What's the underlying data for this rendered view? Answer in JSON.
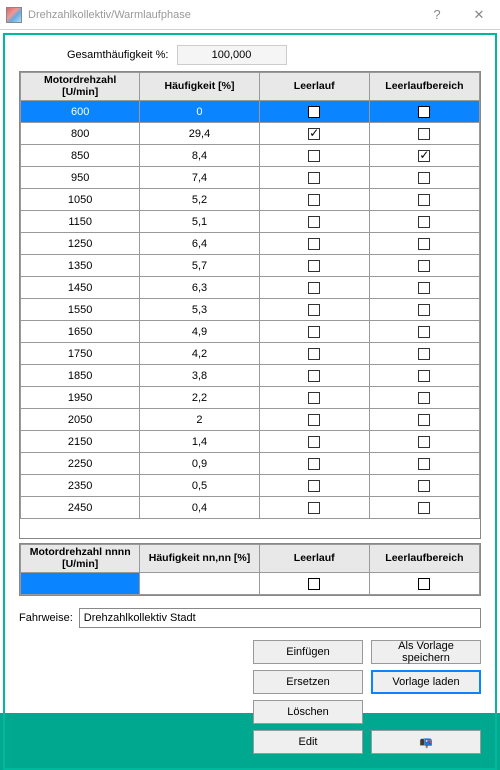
{
  "window": {
    "title": "Drehzahlkollektiv/Warmlaufphase",
    "help": "?",
    "close": "✕"
  },
  "top": {
    "label": "Gesamthäufigkeit %:",
    "value": "100,000"
  },
  "headers": {
    "c1": "Motordrehzahl [U/min]",
    "c2": "Häufigkeit [%]",
    "c3": "Leerlauf",
    "c4": "Leerlauf­bereich"
  },
  "rows": [
    {
      "rpm": "600",
      "freq": "0",
      "leer": false,
      "lb": false,
      "sel": true
    },
    {
      "rpm": "800",
      "freq": "29,4",
      "leer": true,
      "lb": false
    },
    {
      "rpm": "850",
      "freq": "8,4",
      "leer": false,
      "lb": true
    },
    {
      "rpm": "950",
      "freq": "7,4",
      "leer": false,
      "lb": false
    },
    {
      "rpm": "1050",
      "freq": "5,2",
      "leer": false,
      "lb": false
    },
    {
      "rpm": "1150",
      "freq": "5,1",
      "leer": false,
      "lb": false
    },
    {
      "rpm": "1250",
      "freq": "6,4",
      "leer": false,
      "lb": false
    },
    {
      "rpm": "1350",
      "freq": "5,7",
      "leer": false,
      "lb": false
    },
    {
      "rpm": "1450",
      "freq": "6,3",
      "leer": false,
      "lb": false
    },
    {
      "rpm": "1550",
      "freq": "5,3",
      "leer": false,
      "lb": false
    },
    {
      "rpm": "1650",
      "freq": "4,9",
      "leer": false,
      "lb": false
    },
    {
      "rpm": "1750",
      "freq": "4,2",
      "leer": false,
      "lb": false
    },
    {
      "rpm": "1850",
      "freq": "3,8",
      "leer": false,
      "lb": false
    },
    {
      "rpm": "1950",
      "freq": "2,2",
      "leer": false,
      "lb": false
    },
    {
      "rpm": "2050",
      "freq": "2",
      "leer": false,
      "lb": false
    },
    {
      "rpm": "2150",
      "freq": "1,4",
      "leer": false,
      "lb": false
    },
    {
      "rpm": "2250",
      "freq": "0,9",
      "leer": false,
      "lb": false
    },
    {
      "rpm": "2350",
      "freq": "0,5",
      "leer": false,
      "lb": false
    },
    {
      "rpm": "2450",
      "freq": "0,4",
      "leer": false,
      "lb": false
    }
  ],
  "headers2": {
    "c1": "Motordrehzahl nnnn [U/min]",
    "c2": "Häufigkeit nn,nn [%]",
    "c3": "Leerlauf",
    "c4": "Leerlauf­bereich"
  },
  "fahr": {
    "label": "Fahrweise:",
    "value": "Drehzahlkollektiv Stadt"
  },
  "buttons": {
    "einfuegen": "Einfügen",
    "als_vorlage": "Als Vorlage speichern",
    "ersetzen": "Ersetzen",
    "vorlage_laden": "Vorlage laden",
    "loeschen": "Löschen",
    "edit": "Edit"
  }
}
